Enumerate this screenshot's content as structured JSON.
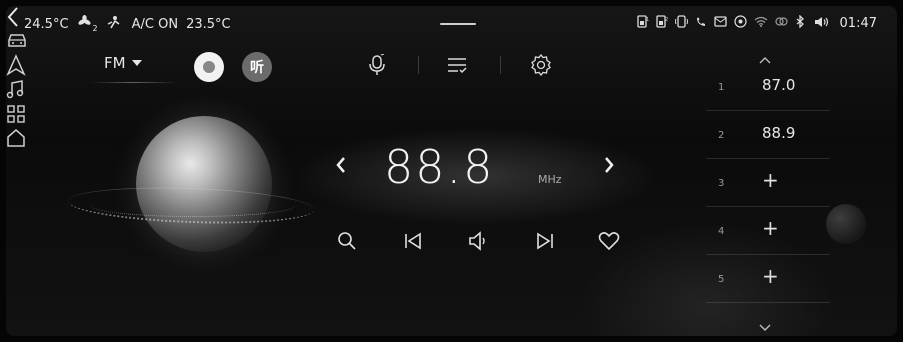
{
  "status": {
    "temperature": "24.5°C",
    "fan_level": "2",
    "ac_status": "A/C ON",
    "ac_temp": "23.5°C",
    "time": "01:47",
    "icons": [
      "sim-card-1-icon",
      "sim-card-2-icon",
      "phone-projection-icon",
      "missed-call-icon",
      "message-icon",
      "hotspot-icon",
      "wifi-icon",
      "link-icon",
      "bluetooth-icon",
      "volume-icon"
    ]
  },
  "rail": {
    "items": [
      {
        "icon": "back-icon"
      },
      {
        "icon": "car-icon"
      },
      {
        "icon": "navigation-icon"
      },
      {
        "icon": "music-icon"
      },
      {
        "icon": "apps-grid-icon"
      },
      {
        "icon": "home-icon"
      }
    ]
  },
  "toolbar": {
    "band": "FM",
    "app2_label": "听",
    "icons": [
      "voice-icon",
      "playlist-icon",
      "settings-icon"
    ]
  },
  "radio": {
    "frequency": "88.8",
    "unit": "MHz"
  },
  "controls": [
    "search-icon",
    "previous-icon",
    "volume-icon",
    "next-icon",
    "favorite-icon"
  ],
  "presets": [
    {
      "index": "1",
      "frequency": "87.0"
    },
    {
      "index": "2",
      "frequency": "88.9"
    },
    {
      "index": "3",
      "frequency": "+"
    },
    {
      "index": "4",
      "frequency": "+"
    },
    {
      "index": "5",
      "frequency": "+"
    }
  ],
  "colors": {
    "background": "#0b0b0b",
    "text": "#e8e8e8",
    "accent_circle": "#6b6b6b"
  }
}
